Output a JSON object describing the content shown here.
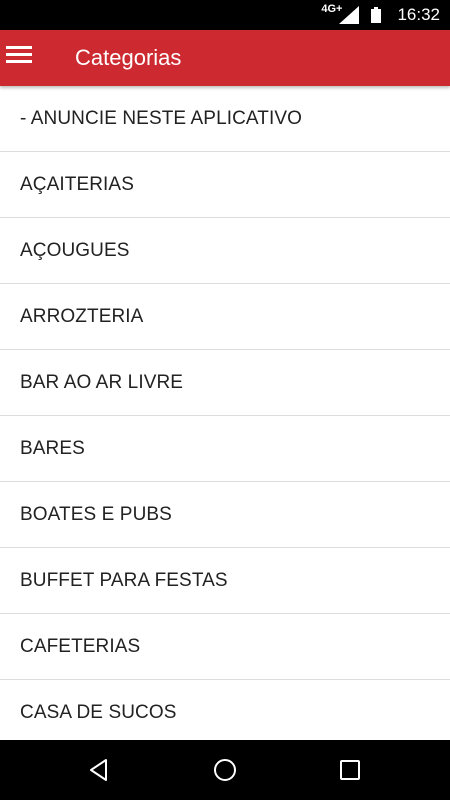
{
  "status_bar": {
    "network": "4G+",
    "time": "16:32",
    "icons": {
      "signal": "cell-signal-icon",
      "battery": "battery-icon"
    }
  },
  "app_bar": {
    "title": "Categorias",
    "menu_icon": "hamburger-menu-icon",
    "color": "#cc2a30"
  },
  "categories": [
    {
      "label": "- ANUNCIE NESTE APLICATIVO"
    },
    {
      "label": "AÇAITERIAS"
    },
    {
      "label": "AÇOUGUES"
    },
    {
      "label": "ARROZTERIA"
    },
    {
      "label": "BAR AO AR LIVRE"
    },
    {
      "label": "BARES"
    },
    {
      "label": "BOATES E PUBS"
    },
    {
      "label": "BUFFET PARA FESTAS"
    },
    {
      "label": "CAFETERIAS"
    },
    {
      "label": "CASA DE SUCOS"
    }
  ],
  "nav_bar": {
    "back_icon": "back-triangle-icon",
    "home_icon": "home-circle-icon",
    "recents_icon": "recents-square-icon"
  }
}
